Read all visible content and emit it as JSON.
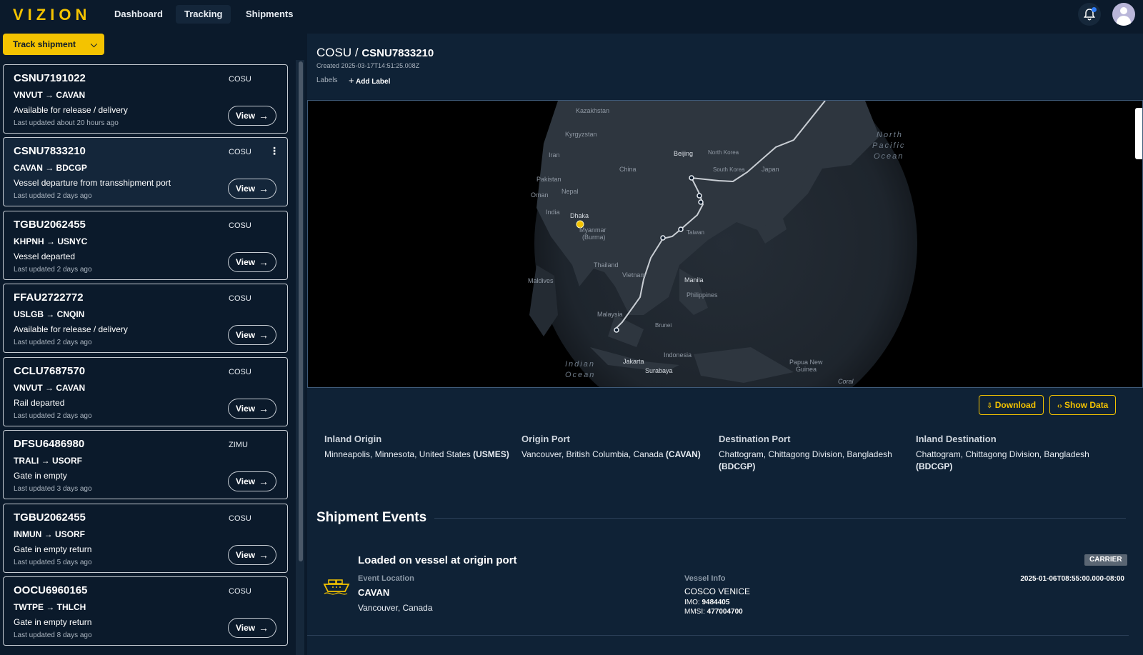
{
  "app": {
    "logo": "VIZION"
  },
  "nav": [
    {
      "label": "Dashboard"
    },
    {
      "label": "Tracking"
    },
    {
      "label": "Shipments"
    }
  ],
  "sidebar": {
    "track_button": "Track shipment",
    "view_label": "View",
    "cards": [
      {
        "id": "CSNU7191022",
        "carrier": "COSU",
        "route": "VNVUT → CAVAN",
        "status": "Available for release / delivery",
        "updated": "Last updated about 20 hours ago"
      },
      {
        "id": "CSNU7833210",
        "carrier": "COSU",
        "route": "CAVAN → BDCGP",
        "status": "Vessel departure from transshipment port",
        "updated": "Last updated 2 days ago"
      },
      {
        "id": "TGBU2062455",
        "carrier": "COSU",
        "route": "KHPNH → USNYC",
        "status": "Vessel departed",
        "updated": "Last updated 2 days ago"
      },
      {
        "id": "FFAU2722772",
        "carrier": "COSU",
        "route": "USLGB → CNQIN",
        "status": "Available for release / delivery",
        "updated": "Last updated 2 days ago"
      },
      {
        "id": "CCLU7687570",
        "carrier": "COSU",
        "route": "VNVUT → CAVAN",
        "status": "Rail departed",
        "updated": "Last updated 2 days ago"
      },
      {
        "id": "DFSU6486980",
        "carrier": "ZIMU",
        "route": "TRALI → USORF",
        "status": "Gate in empty",
        "updated": "Last updated 3 days ago"
      },
      {
        "id": "TGBU2062455",
        "carrier": "COSU",
        "route": "INMUN → USORF",
        "status": "Gate in empty return",
        "updated": "Last updated 5 days ago"
      },
      {
        "id": "OOCU6960165",
        "carrier": "COSU",
        "route": "TWTPE → THLCH",
        "status": "Gate in empty return",
        "updated": "Last updated 8 days ago"
      }
    ]
  },
  "detail": {
    "carrier": "COSU",
    "separator": "/",
    "container": "CSNU7833210",
    "created": "Created 2025-03-17T14:51:25.008Z",
    "labels_label": "Labels",
    "add_label": "Add Label",
    "download": "Download",
    "show_data": "Show Data"
  },
  "map": {
    "labels": {
      "kazakhstan": "Kazakhstan",
      "kyrgyzstan": "Kyrgyzstan",
      "iran": "Iran",
      "pakistan": "Pakistan",
      "oman": "Oman",
      "nepal": "Nepal",
      "india": "India",
      "dhaka": "Dhaka",
      "myanmar": "Myanmar",
      "burma": "(Burma)",
      "thailand": "Thailand",
      "vietnam": "Vietnam",
      "maldives": "Maldives",
      "malaysia": "Malaysia",
      "china": "China",
      "beijing": "Beijing",
      "north_korea": "North Korea",
      "south_korea": "South Korea",
      "japan": "Japan",
      "taiwan": "Taiwan",
      "manila": "Manila",
      "philippines": "Philippines",
      "brunei": "Brunei",
      "indonesia": "Indonesia",
      "jakarta": "Jakarta",
      "surabaya": "Surabaya",
      "papua": "Papua New",
      "guinea": "Guinea",
      "coral": "Coral",
      "north": "North",
      "pacific": "Pacific",
      "ocean": "Ocean",
      "indian": "Indian",
      "indian_ocean": "Ocean"
    }
  },
  "ports": [
    {
      "heading": "Inland Origin",
      "place": "Minneapolis, Minnesota, United States",
      "code": "(USMES)"
    },
    {
      "heading": "Origin Port",
      "place": "Vancouver, British Columbia, Canada",
      "code": "(CAVAN)"
    },
    {
      "heading": "Destination Port",
      "place": "Chattogram, Chittagong Division, Bangladesh",
      "code": "(BDCGP)"
    },
    {
      "heading": "Inland Destination",
      "place": "Chattogram, Chittagong Division, Bangladesh",
      "code": "(BDCGP)"
    }
  ],
  "events": {
    "title": "Shipment Events",
    "items": [
      {
        "title": "Loaded on vessel at origin port",
        "badge": "CARRIER",
        "location_label": "Event Location",
        "location_code": "CAVAN",
        "location_city": "Vancouver, Canada",
        "vessel_label": "Vessel Info",
        "vessel_name": "COSCO VENICE",
        "imo_label": "IMO:",
        "imo": "9484405",
        "mmsi_label": "MMSI:",
        "mmsi": "477004700",
        "timestamp": "2025-01-06T08:55:00.000-08:00"
      }
    ]
  },
  "colors": {
    "accent": "#f4c300",
    "background": "#0b1a2b",
    "panel": "#0f2236",
    "route": "#c9ced4"
  }
}
